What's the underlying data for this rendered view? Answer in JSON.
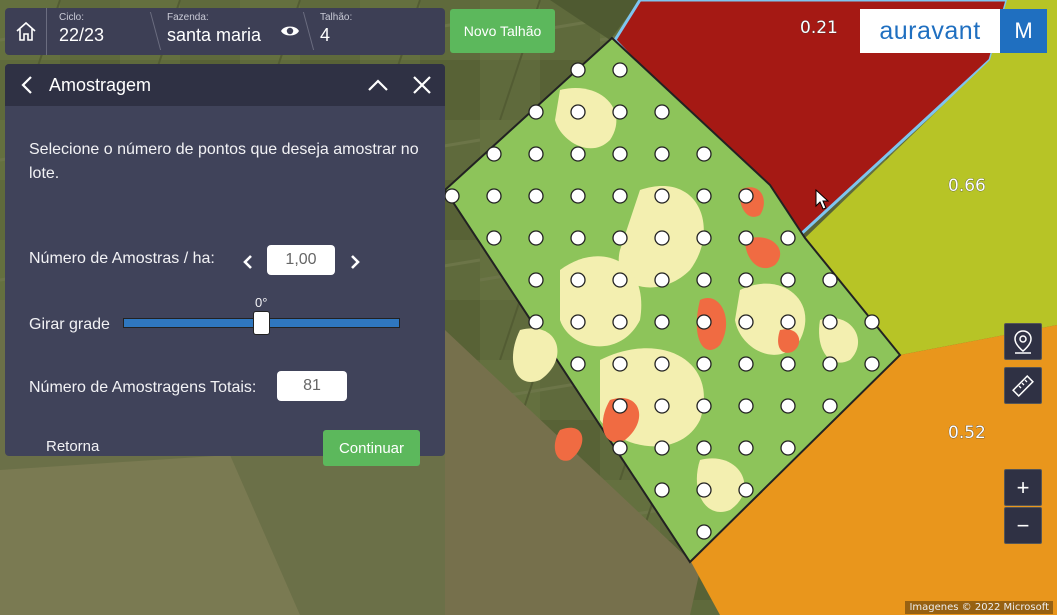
{
  "header": {
    "ciclo_label": "Ciclo:",
    "ciclo_value": "22/23",
    "fazenda_label": "Fazenda:",
    "fazenda_value": "santa maria",
    "talhao_label": "Talhão:",
    "talhao_value": "4",
    "new_field_button": "Novo Talhão"
  },
  "logo": {
    "brand_text": "auravant",
    "user_initial": "M",
    "brand_color": "#1f6fc0"
  },
  "panel": {
    "title": "Amostragem",
    "intro": "Selecione o número de pontos que deseja amostrar no lote.",
    "samples_per_ha_label": "Número de Amostras / ha:",
    "samples_per_ha_value": "1,00",
    "rotate_label": "Girar grade",
    "rotate_value": "0°",
    "rotate_fraction": 0.5,
    "total_label": "Número de Amostragens Totais:",
    "total_value": "81",
    "back_button": "Retorna",
    "continue_button": "Continuar",
    "accent_color": "#5cb85c"
  },
  "map": {
    "zone_values": [
      "0.21",
      "0.66",
      "0.52"
    ],
    "zone_colors": [
      "#a51914",
      "#b7c426",
      "#e9961c"
    ],
    "attribution": "Imagenes © 2022 Microsoft"
  },
  "tools": {
    "icons": [
      "location-pin-icon",
      "ruler-icon",
      "zoom-in-icon",
      "zoom-out-icon"
    ],
    "zoom_in": "+",
    "zoom_out": "−"
  }
}
